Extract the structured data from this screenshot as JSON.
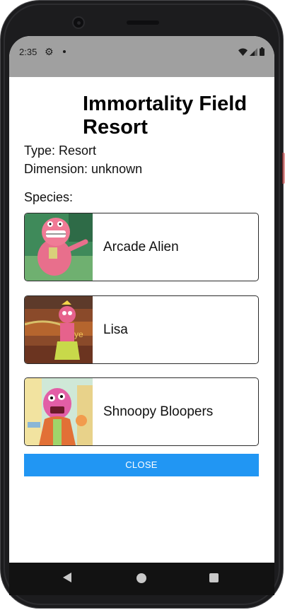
{
  "status_bar": {
    "time": "2:35",
    "icons": [
      "settings-icon",
      "notification-dot-icon",
      "wifi-icon",
      "signal-icon",
      "battery-icon"
    ]
  },
  "location": {
    "name": "Immortality Field Resort",
    "type_line": "Type: Resort",
    "dimension_line": "Dimension: unknown",
    "species_label": "Species:"
  },
  "species": [
    {
      "name": "Arcade Alien",
      "image_icon": "character-portrait"
    },
    {
      "name": "Lisa",
      "image_icon": "character-portrait"
    },
    {
      "name": "Shnoopy Bloopers",
      "image_icon": "character-portrait"
    }
  ],
  "actions": {
    "close_label": "CLOSE"
  },
  "nav_bar": {
    "icons": [
      "back-icon",
      "home-icon",
      "recents-icon"
    ]
  },
  "colors": {
    "accent": "#2196f3",
    "status_bar": "#a0a0a0",
    "nav_bar": "#121212"
  }
}
